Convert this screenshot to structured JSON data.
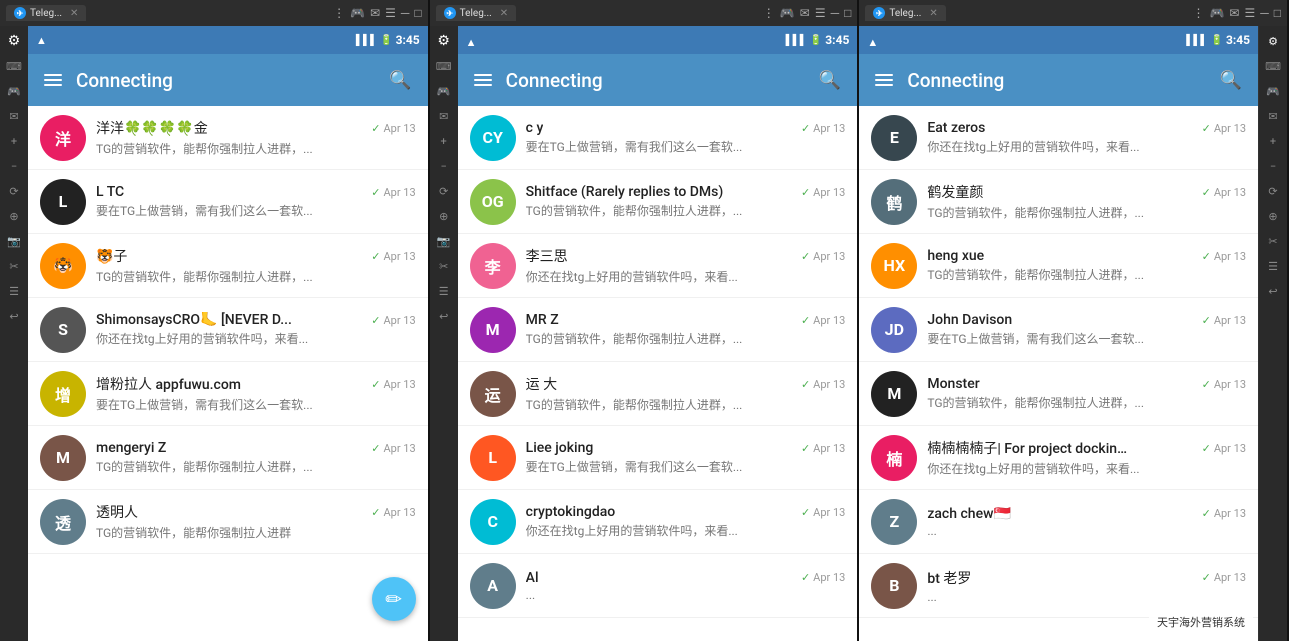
{
  "windows": [
    {
      "id": "win1",
      "tab_label": "Teleg...",
      "status_time": "3:45",
      "title_bar": {
        "title": "Connecting",
        "menu_icon": "≡",
        "search_icon": "🔍"
      },
      "chats": [
        {
          "name": "洋洋🍀🍀🍀🍀金",
          "preview": "TG的营销软件，能帮你强制拉人进群，...",
          "date": "Apr 13",
          "avatar_text": "洋",
          "avatar_color": "#e91e63"
        },
        {
          "name": "L TC",
          "preview": "要在TG上做营销，需有我们这么一套软...",
          "date": "Apr 13",
          "avatar_text": "L",
          "avatar_color": "#222"
        },
        {
          "name": "🐯子",
          "preview": "TG的营销软件，能帮你强制拉人进群，...",
          "date": "Apr 13",
          "avatar_text": "🐯",
          "avatar_color": "#ff8f00"
        },
        {
          "name": "ShimonsaysCRO🦶 [NEVER D...",
          "preview": "你还在找tg上好用的营销软件吗，来看...",
          "date": "Apr 13",
          "avatar_text": "S",
          "avatar_color": "#555"
        },
        {
          "name": "增粉拉人 appfuwu.com",
          "preview": "要在TG上做营销，需有我们这么一套软...",
          "date": "Apr 13",
          "avatar_text": "增",
          "avatar_color": "#c8b400"
        },
        {
          "name": "mengeryi Z",
          "preview": "TG的营销软件，能帮你强制拉人进群，...",
          "date": "Apr 13",
          "avatar_text": "M",
          "avatar_color": "#795548"
        },
        {
          "name": "透明人",
          "preview": "TG的营销软件，能帮你强制拉人进群",
          "date": "Apr 13",
          "avatar_text": "透",
          "avatar_color": "#607d8b"
        }
      ]
    },
    {
      "id": "win2",
      "tab_label": "Teleg...",
      "status_time": "3:45",
      "title_bar": {
        "title": "Connecting",
        "menu_icon": "≡",
        "search_icon": "🔍"
      },
      "chats": [
        {
          "name": "c y",
          "preview": "要在TG上做营销，需有我们这么一套软...",
          "date": "Apr 13",
          "avatar_text": "CY",
          "avatar_color": "#00bcd4"
        },
        {
          "name": "Shitface (Rarely replies to DMs)",
          "preview": "TG的营销软件，能帮你强制拉人进群，...",
          "date": "Apr 13",
          "avatar_text": "OG",
          "avatar_color": "#8bc34a"
        },
        {
          "name": "李三思",
          "preview": "你还在找tg上好用的营销软件吗，来看...",
          "date": "Apr 13",
          "avatar_text": "李",
          "avatar_color": "#f06292"
        },
        {
          "name": "MR Z",
          "preview": "TG的营销软件，能帮你强制拉人进群，...",
          "date": "Apr 13",
          "avatar_text": "M",
          "avatar_color": "#9c27b0"
        },
        {
          "name": "运 大",
          "preview": "TG的营销软件，能帮你强制拉人进群，...",
          "date": "Apr 13",
          "avatar_text": "运",
          "avatar_color": "#795548"
        },
        {
          "name": "Liee joking",
          "preview": "要在TG上做营销，需有我们这么一套软...",
          "date": "Apr 13",
          "avatar_text": "L",
          "avatar_color": "#ff5722"
        },
        {
          "name": "cryptokingdao",
          "preview": "你还在找tg上好用的营销软件吗，来看...",
          "date": "Apr 13",
          "avatar_text": "C",
          "avatar_color": "#00bcd4"
        },
        {
          "name": "Al",
          "preview": "...",
          "date": "Apr 13",
          "avatar_text": "A",
          "avatar_color": "#607d8b"
        }
      ]
    },
    {
      "id": "win3",
      "tab_label": "Teleg...",
      "status_time": "3:45",
      "title_bar": {
        "title": "Connecting",
        "menu_icon": "≡",
        "search_icon": "🔍"
      },
      "chats": [
        {
          "name": "Eat zeros",
          "preview": "你还在找tg上好用的营销软件吗，来看...",
          "date": "Apr 13",
          "avatar_text": "E",
          "avatar_color": "#37474f"
        },
        {
          "name": "鹤发童颜",
          "preview": "TG的营销软件，能帮你强制拉人进群，...",
          "date": "Apr 13",
          "avatar_text": "鹤",
          "avatar_color": "#546e7a"
        },
        {
          "name": "heng xue",
          "preview": "TG的营销软件，能帮你强制拉人进群，...",
          "date": "Apr 13",
          "avatar_text": "HX",
          "avatar_color": "#ff8f00"
        },
        {
          "name": "John Davison",
          "preview": "要在TG上做营销，需有我们这么一套软...",
          "date": "Apr 13",
          "avatar_text": "JD",
          "avatar_color": "#5c6bc0"
        },
        {
          "name": "Monster",
          "preview": "TG的营销软件，能帮你强制拉人进群，...",
          "date": "Apr 13",
          "avatar_text": "M",
          "avatar_color": "#222"
        },
        {
          "name": "楠楠楠楠子| For project dockin...",
          "preview": "你还在找tg上好用的营销软件吗，来看...",
          "date": "Apr 13",
          "avatar_text": "楠",
          "avatar_color": "#e91e63"
        },
        {
          "name": "zach chew🇸🇬",
          "preview": "...",
          "date": "Apr 13",
          "avatar_text": "Z",
          "avatar_color": "#607d8b"
        },
        {
          "name": "bt 老罗",
          "preview": "...",
          "date": "Apr 13",
          "avatar_text": "B",
          "avatar_color": "#795548"
        }
      ]
    }
  ],
  "watermark": "天宇海外营销系统",
  "side_controls": {
    "icons": [
      "⌨",
      "🎮",
      "📧",
      "☰",
      "◼",
      "🔲",
      "↩",
      "✂",
      "☰",
      "📋",
      "↩"
    ]
  }
}
